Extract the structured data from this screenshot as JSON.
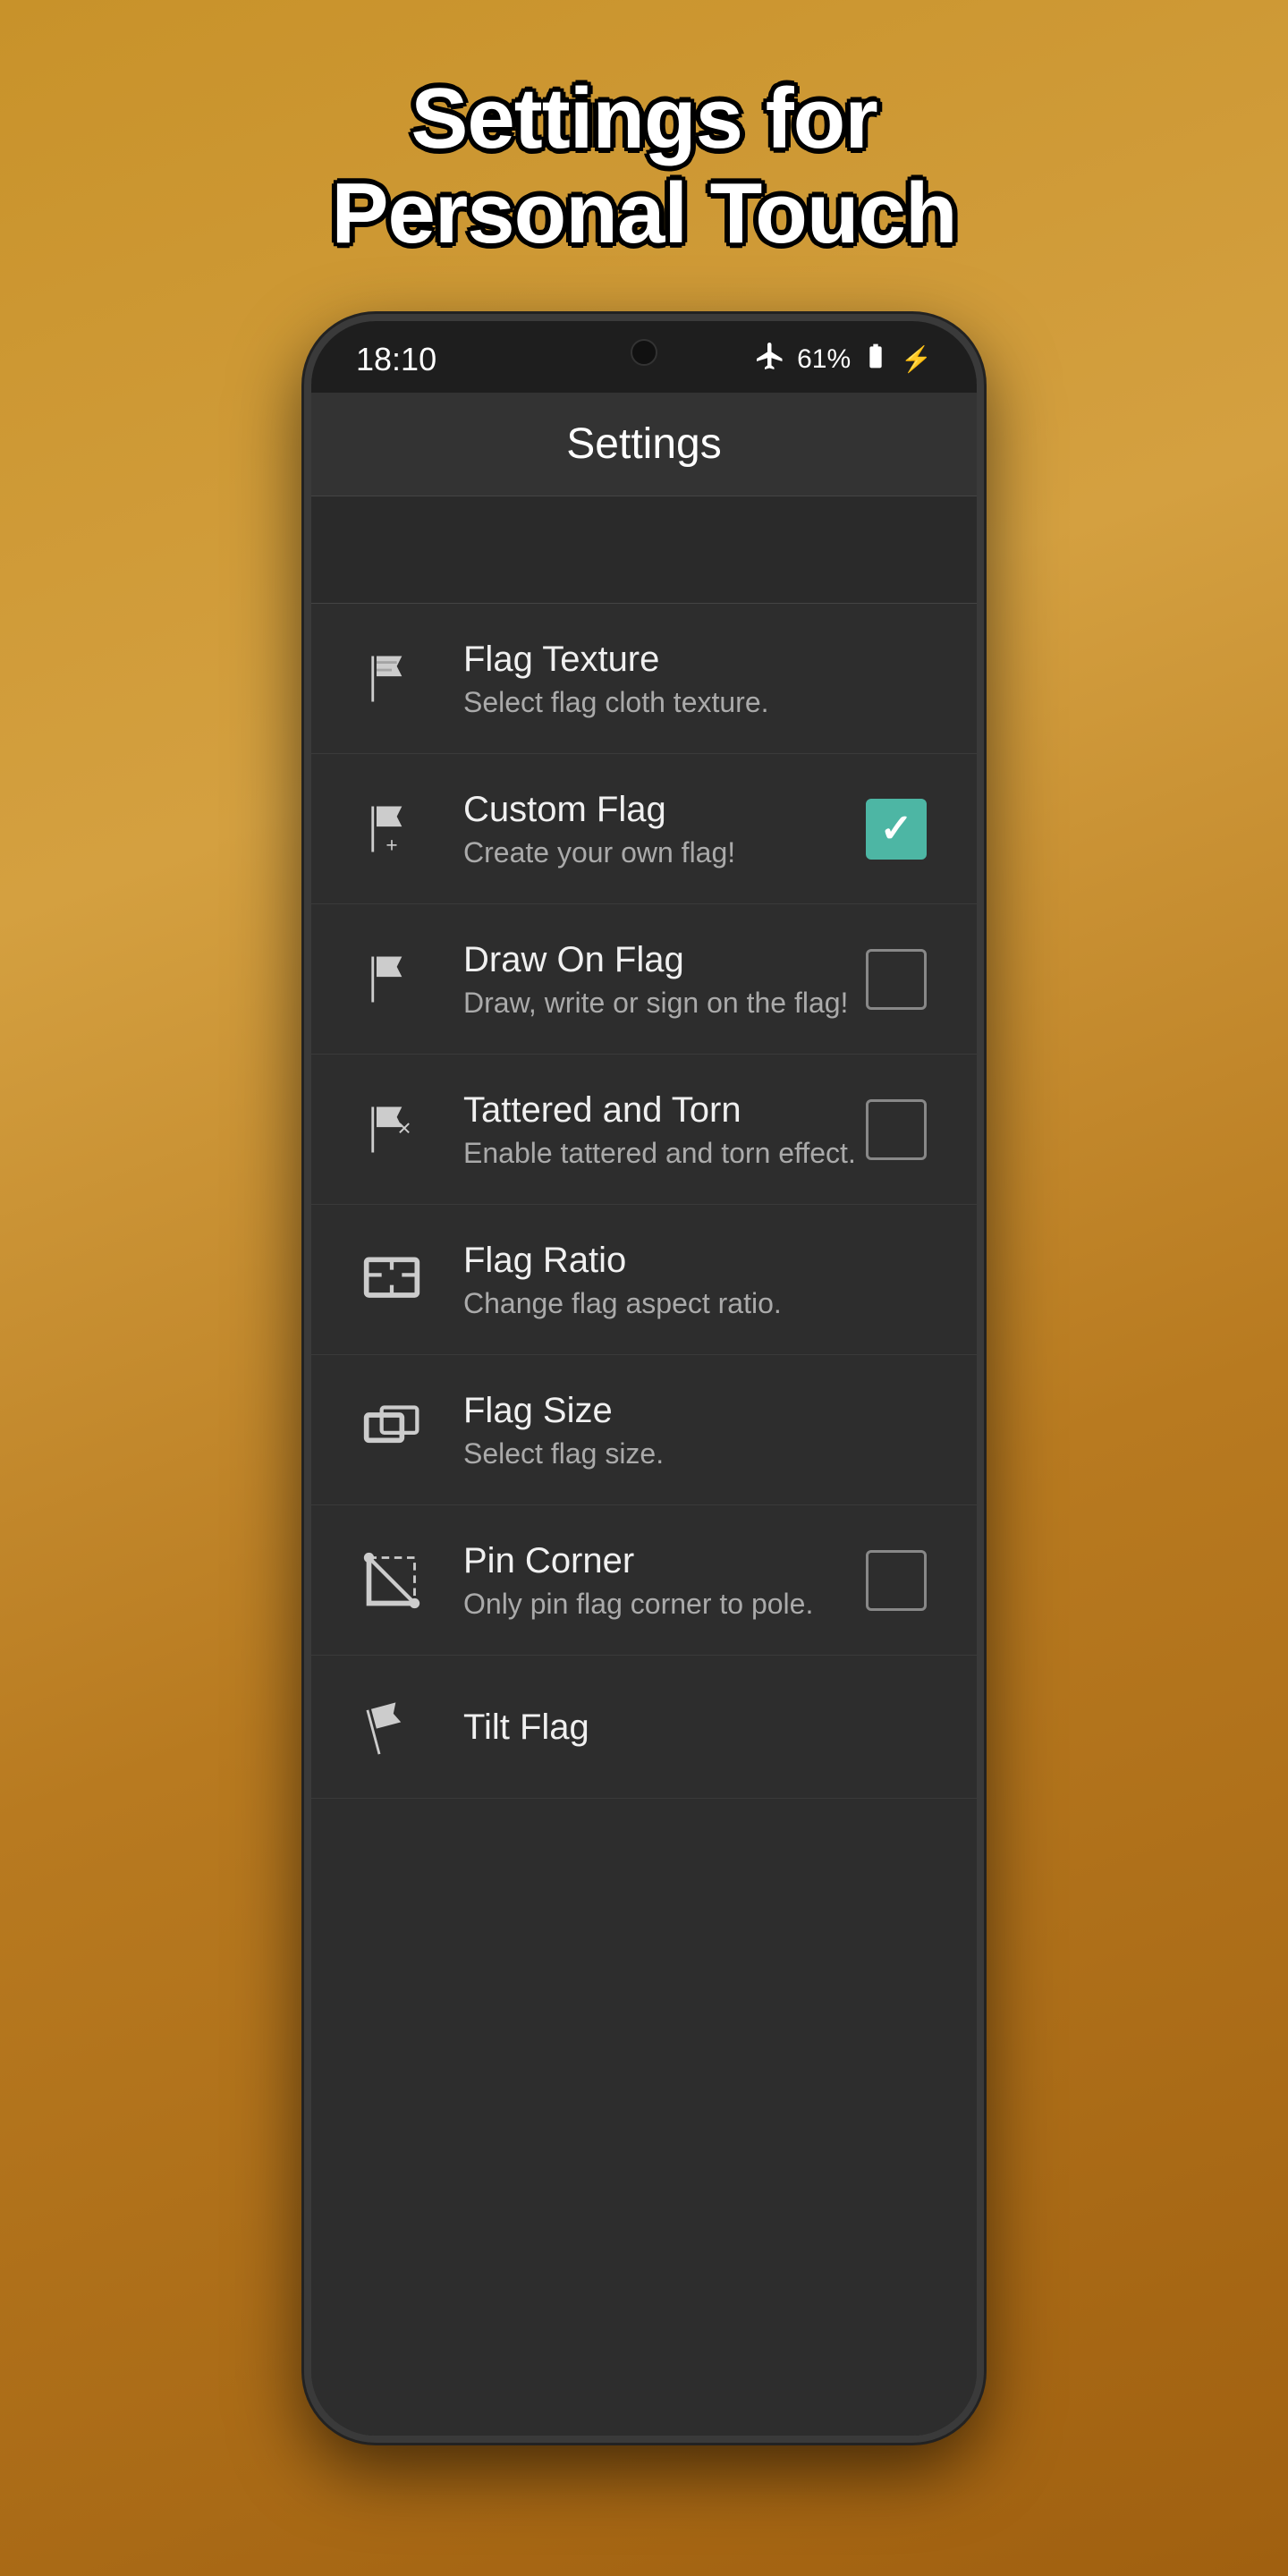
{
  "page": {
    "title_line1": "Settings for",
    "title_line2": "Personal Touch"
  },
  "status_bar": {
    "time": "18:10",
    "battery": "61%"
  },
  "app_bar": {
    "title": "Settings"
  },
  "settings": [
    {
      "id": "flag-texture",
      "title": "Flag Texture",
      "subtitle": "Select flag cloth texture.",
      "has_checkbox": false,
      "checked": false,
      "icon": "flag-texture-icon"
    },
    {
      "id": "custom-flag",
      "title": "Custom Flag",
      "subtitle": "Create your own flag!",
      "has_checkbox": true,
      "checked": true,
      "icon": "custom-flag-icon"
    },
    {
      "id": "draw-on-flag",
      "title": "Draw On Flag",
      "subtitle": "Draw, write or sign on the flag!",
      "has_checkbox": true,
      "checked": false,
      "icon": "draw-flag-icon"
    },
    {
      "id": "tattered-torn",
      "title": "Tattered and Torn",
      "subtitle": "Enable tattered and torn effect.",
      "has_checkbox": true,
      "checked": false,
      "icon": "tattered-flag-icon"
    },
    {
      "id": "flag-ratio",
      "title": "Flag Ratio",
      "subtitle": "Change flag aspect ratio.",
      "has_checkbox": false,
      "checked": false,
      "icon": "flag-ratio-icon"
    },
    {
      "id": "flag-size",
      "title": "Flag Size",
      "subtitle": "Select flag size.",
      "has_checkbox": false,
      "checked": false,
      "icon": "flag-size-icon"
    },
    {
      "id": "pin-corner",
      "title": "Pin Corner",
      "subtitle": "Only pin flag corner to pole.",
      "has_checkbox": true,
      "checked": false,
      "icon": "pin-corner-icon"
    },
    {
      "id": "tilt-flag",
      "title": "Tilt Flag",
      "subtitle": "",
      "has_checkbox": false,
      "checked": false,
      "icon": "tilt-flag-icon"
    }
  ]
}
